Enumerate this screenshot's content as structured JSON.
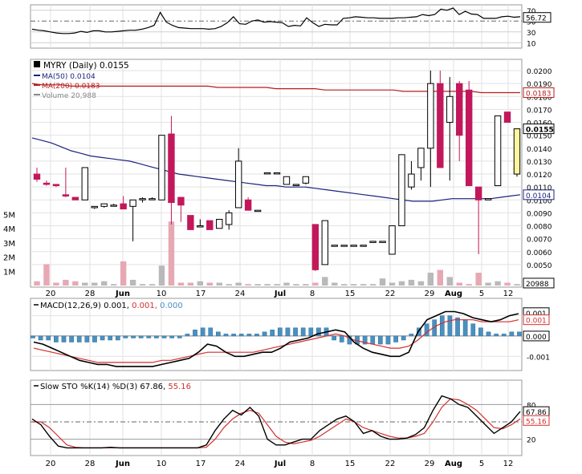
{
  "chart_data": [
    {
      "type": "line",
      "panel": "rsi",
      "y_ticks": [
        70,
        50,
        30,
        10
      ],
      "last_value": "56.72",
      "ylim": [
        0,
        80
      ],
      "series": [
        {
          "values": [
            35,
            33,
            32,
            30,
            28,
            27,
            27,
            28,
            31,
            29,
            32,
            32,
            30,
            30,
            31,
            32,
            33,
            33,
            35,
            38,
            42,
            66,
            48,
            42,
            38,
            37,
            36,
            36,
            36,
            35,
            36,
            40,
            47,
            58,
            45,
            44,
            50,
            52,
            48,
            49,
            48,
            47,
            40,
            42,
            41,
            56,
            47,
            40,
            44,
            43,
            43,
            55,
            56,
            58,
            57,
            56,
            56,
            55,
            55,
            55,
            56,
            56,
            57,
            58,
            62,
            60,
            62,
            72,
            70,
            74,
            62,
            68,
            63,
            62,
            55,
            55,
            55,
            58,
            59,
            57,
            58
          ]
        }
      ]
    },
    {
      "type": "candlestick",
      "panel": "price",
      "title": "MYRY (Daily) 0.0155",
      "legend": [
        {
          "label": "MA(50) 0.0104",
          "color": "#1a237e"
        },
        {
          "label": "MA(200) 0.0183",
          "color": "#b71c1c"
        },
        {
          "label": "Volume 20,988",
          "color": "#888888"
        }
      ],
      "price_ticks": [
        "0.0200",
        "0.0190",
        "0.0180",
        "0.0170",
        "0.0160",
        "0.0150",
        "0.0140",
        "0.0130",
        "0.0120",
        "0.0110",
        "0.0100",
        "0.0090",
        "0.0080",
        "0.0070",
        "0.0060",
        "0.0050"
      ],
      "volume_ticks": [
        "5M",
        "4M",
        "3M",
        "2M",
        "1M"
      ],
      "badges": [
        {
          "text": "0.0183",
          "color": "#b71c1c"
        },
        {
          "text": "0.0155",
          "color": "#000000"
        },
        {
          "text": "0.0104",
          "color": "#1a237e"
        },
        {
          "text": "20988",
          "color": "#000000"
        }
      ],
      "candles": [
        {
          "o": 0.012,
          "h": 0.0125,
          "l": 0.0114,
          "c": 0.0116,
          "v": 0.3
        },
        {
          "o": 0.0113,
          "h": 0.0115,
          "l": 0.0111,
          "c": 0.0112,
          "v": 1.5
        },
        {
          "o": 0.0112,
          "h": 0.0112,
          "l": 0.011,
          "c": 0.0111,
          "v": 0.2
        },
        {
          "o": 0.0104,
          "h": 0.0125,
          "l": 0.0102,
          "c": 0.0103,
          "v": 0.4
        },
        {
          "o": 0.0102,
          "h": 0.0102,
          "l": 0.01,
          "c": 0.01,
          "v": 0.3
        },
        {
          "o": 0.01,
          "h": 0.0125,
          "l": 0.01,
          "c": 0.0125,
          "v": 0.2
        },
        {
          "o": 0.0094,
          "h": 0.0095,
          "l": 0.0093,
          "c": 0.0095,
          "v": 0.2
        },
        {
          "o": 0.0095,
          "h": 0.0097,
          "l": 0.0094,
          "c": 0.0097,
          "v": 0.3
        },
        {
          "o": 0.0096,
          "h": 0.0097,
          "l": 0.0096,
          "c": 0.0096,
          "v": 0.1
        },
        {
          "o": 0.0097,
          "h": 0.0103,
          "l": 0.0094,
          "c": 0.0093,
          "v": 1.7
        },
        {
          "o": 0.0095,
          "h": 0.01,
          "l": 0.0068,
          "c": 0.01,
          "v": 0.4
        },
        {
          "o": 0.0101,
          "h": 0.0102,
          "l": 0.0098,
          "c": 0.0101,
          "v": 0.1
        },
        {
          "o": 0.0101,
          "h": 0.0102,
          "l": 0.01,
          "c": 0.0101,
          "v": 0.1
        },
        {
          "o": 0.01,
          "h": 0.015,
          "l": 0.01,
          "c": 0.015,
          "v": 1.4
        },
        {
          "o": 0.0151,
          "h": 0.0165,
          "l": 0.0081,
          "c": 0.0098,
          "v": 4.5
        },
        {
          "o": 0.0102,
          "h": 0.0102,
          "l": 0.0083,
          "c": 0.0096,
          "v": 0.2
        },
        {
          "o": 0.0088,
          "h": 0.0088,
          "l": 0.0077,
          "c": 0.0077,
          "v": 0.2
        },
        {
          "o": 0.008,
          "h": 0.0085,
          "l": 0.008,
          "c": 0.008,
          "v": 0.3
        },
        {
          "o": 0.0084,
          "h": 0.0084,
          "l": 0.0077,
          "c": 0.0077,
          "v": 0.2
        },
        {
          "o": 0.0078,
          "h": 0.0085,
          "l": 0.0078,
          "c": 0.0085,
          "v": 0.2
        },
        {
          "o": 0.0081,
          "h": 0.0092,
          "l": 0.0077,
          "c": 0.009,
          "v": 0.1
        },
        {
          "o": 0.0094,
          "h": 0.014,
          "l": 0.0094,
          "c": 0.013,
          "v": 0.2
        },
        {
          "o": 0.01,
          "h": 0.0102,
          "l": 0.0093,
          "c": 0.0092,
          "v": 0.1
        },
        {
          "o": 0.0092,
          "h": 0.0092,
          "l": 0.0092,
          "c": 0.0092,
          "v": 0.1
        },
        {
          "o": 0.0121,
          "h": 0.0121,
          "l": 0.0121,
          "c": 0.0121,
          "v": 0.1
        },
        {
          "o": 0.0121,
          "h": 0.0121,
          "l": 0.0121,
          "c": 0.0121,
          "v": 0.1
        },
        {
          "o": 0.0112,
          "h": 0.0118,
          "l": 0.0112,
          "c": 0.0118,
          "v": 0.2
        },
        {
          "o": 0.0112,
          "h": 0.0112,
          "l": 0.0112,
          "c": 0.0112,
          "v": 0.1
        },
        {
          "o": 0.0113,
          "h": 0.0118,
          "l": 0.0112,
          "c": 0.0118,
          "v": 0.1
        },
        {
          "o": 0.0081,
          "h": 0.0081,
          "l": 0.0045,
          "c": 0.0046,
          "v": 0.2
        },
        {
          "o": 0.005,
          "h": 0.0084,
          "l": 0.005,
          "c": 0.0084,
          "v": 0.6
        },
        {
          "o": 0.0065,
          "h": 0.0065,
          "l": 0.0065,
          "c": 0.0065,
          "v": 0.2
        },
        {
          "o": 0.0065,
          "h": 0.0065,
          "l": 0.0065,
          "c": 0.0065,
          "v": 0.1
        },
        {
          "o": 0.0065,
          "h": 0.0065,
          "l": 0.0065,
          "c": 0.0065,
          "v": 0.1
        },
        {
          "o": 0.0065,
          "h": 0.0065,
          "l": 0.0065,
          "c": 0.0065,
          "v": 0.1
        },
        {
          "o": 0.0068,
          "h": 0.0068,
          "l": 0.0068,
          "c": 0.0068,
          "v": 0.1
        },
        {
          "o": 0.0068,
          "h": 0.0068,
          "l": 0.0068,
          "c": 0.0068,
          "v": 0.5
        },
        {
          "o": 0.0058,
          "h": 0.008,
          "l": 0.0058,
          "c": 0.008,
          "v": 0.2
        },
        {
          "o": 0.008,
          "h": 0.0135,
          "l": 0.008,
          "c": 0.0135,
          "v": 0.3
        },
        {
          "o": 0.011,
          "h": 0.013,
          "l": 0.0108,
          "c": 0.012,
          "v": 0.4
        },
        {
          "o": 0.0125,
          "h": 0.014,
          "l": 0.0115,
          "c": 0.014,
          "v": 0.3
        },
        {
          "o": 0.014,
          "h": 0.02,
          "l": 0.011,
          "c": 0.019,
          "v": 0.9
        },
        {
          "o": 0.019,
          "h": 0.02,
          "l": 0.0125,
          "c": 0.0125,
          "v": 1.1
        },
        {
          "o": 0.016,
          "h": 0.0195,
          "l": 0.0115,
          "c": 0.018,
          "v": 0.6
        },
        {
          "o": 0.019,
          "h": 0.0192,
          "l": 0.013,
          "c": 0.015,
          "v": 0.2
        },
        {
          "o": 0.0185,
          "h": 0.0192,
          "l": 0.0111,
          "c": 0.0111,
          "v": 0.1
        },
        {
          "o": 0.011,
          "h": 0.011,
          "l": 0.0058,
          "c": 0.01,
          "v": 0.9
        },
        {
          "o": 0.01,
          "h": 0.0101,
          "l": 0.01,
          "c": 0.0101,
          "v": 0.2
        },
        {
          "o": 0.0111,
          "h": 0.0165,
          "l": 0.0111,
          "c": 0.0165,
          "v": 0.3
        },
        {
          "o": 0.0168,
          "h": 0.0168,
          "l": 0.016,
          "c": 0.016,
          "v": 0.2
        },
        {
          "o": 0.012,
          "h": 0.0155,
          "l": 0.0118,
          "c": 0.0155,
          "v": 0.1
        }
      ],
      "ma50": [
        0.0148,
        0.0146,
        0.0144,
        0.0141,
        0.0138,
        0.0136,
        0.0134,
        0.0133,
        0.0132,
        0.0131,
        0.013,
        0.0128,
        0.0126,
        0.0124,
        0.0122,
        0.012,
        0.0119,
        0.0118,
        0.0117,
        0.0116,
        0.0115,
        0.0114,
        0.0113,
        0.0112,
        0.0111,
        0.0111,
        0.011,
        0.011,
        0.011,
        0.0109,
        0.0108,
        0.0107,
        0.0106,
        0.0105,
        0.0104,
        0.0103,
        0.0102,
        0.0101,
        0.01,
        0.0099,
        0.0099,
        0.0099,
        0.01,
        0.0101,
        0.0101,
        0.0101,
        0.0101,
        0.0101,
        0.0102,
        0.0103,
        0.0104
      ],
      "ma200": [
        0.019,
        0.0189,
        0.0189,
        0.0189,
        0.0188,
        0.0188,
        0.0188,
        0.0188,
        0.0188,
        0.0188,
        0.0188,
        0.0188,
        0.0188,
        0.0188,
        0.0188,
        0.0188,
        0.0188,
        0.0188,
        0.0188,
        0.0187,
        0.0187,
        0.0187,
        0.0187,
        0.0187,
        0.0187,
        0.0186,
        0.0186,
        0.0186,
        0.0186,
        0.0186,
        0.0185,
        0.0185,
        0.0185,
        0.0185,
        0.0185,
        0.0185,
        0.0185,
        0.0185,
        0.0184,
        0.0184,
        0.0184,
        0.0184,
        0.0184,
        0.0184,
        0.0184,
        0.0184,
        0.0183,
        0.0183,
        0.0183,
        0.0183,
        0.0183
      ]
    },
    {
      "type": "bar",
      "panel": "macd",
      "title_parts": [
        {
          "text": "MACD(12,26,9) 0.001, ",
          "color": "#000000"
        },
        {
          "text": "0.001, ",
          "color": "#d32f2f"
        },
        {
          "text": "0.000",
          "color": "#4a90c0"
        }
      ],
      "y_ticks": [
        "0.001",
        "0.000",
        "-0.001"
      ],
      "badges": [
        {
          "text": "0.001",
          "color": "#000000"
        },
        {
          "text": "0.001",
          "color": "#d32f2f"
        },
        {
          "text": "0.000",
          "color": "#000000"
        }
      ],
      "histogram": [
        -0.0001,
        -0.0002,
        -0.0002,
        -0.0003,
        -0.0003,
        -0.0003,
        -0.0003,
        -0.0003,
        -0.0003,
        -0.0002,
        -0.0002,
        -0.0002,
        -0.0001,
        -0.0001,
        -0.0001,
        -0.0001,
        -0.0001,
        -0.0001,
        -0.0001,
        -0.0001,
        0.0001,
        0.0003,
        0.0004,
        0.0004,
        0.0002,
        0.0001,
        0.0001,
        0.0001,
        0.0001,
        0.0001,
        0.0002,
        0.0003,
        0.0004,
        0.0004,
        0.0004,
        0.0004,
        0.0004,
        0.0004,
        0.0004,
        -0.0002,
        -0.0003,
        -0.0004,
        -0.0004,
        -0.0004,
        -0.0004,
        -0.0004,
        -0.0004,
        -0.0003,
        -0.0002,
        0.0001,
        0.0004,
        0.0006,
        0.0008,
        0.001,
        0.001,
        0.0009,
        0.0008,
        0.0006,
        0.0004,
        0.0002,
        0.0001,
        0.0001,
        0.0002,
        0.0002
      ],
      "macd": [
        -0.0003,
        -0.0004,
        -0.0006,
        -0.0008,
        -0.001,
        -0.0012,
        -0.0013,
        -0.0014,
        -0.0014,
        -0.0015,
        -0.0015,
        -0.0015,
        -0.0015,
        -0.0015,
        -0.0014,
        -0.0013,
        -0.0012,
        -0.0011,
        -0.0008,
        -0.0004,
        -0.0005,
        -0.0008,
        -0.001,
        -0.001,
        -0.0009,
        -0.0008,
        -0.0008,
        -0.0006,
        -0.0003,
        -0.0002,
        -0.0001,
        0.0001,
        0.0002,
        0.0003,
        0.0002,
        -0.0003,
        -0.0006,
        -0.0008,
        -0.0009,
        -0.001,
        -0.001,
        -0.0008,
        0.0002,
        0.0008,
        0.001,
        0.0012,
        0.0012,
        0.0011,
        0.0009,
        0.0008,
        0.0007,
        0.0008,
        0.001,
        0.0011
      ],
      "signal": [
        -0.0006,
        -0.0007,
        -0.0008,
        -0.0009,
        -0.001,
        -0.0011,
        -0.0012,
        -0.0013,
        -0.0013,
        -0.0013,
        -0.0013,
        -0.0013,
        -0.0013,
        -0.0013,
        -0.0012,
        -0.0012,
        -0.0011,
        -0.001,
        -0.0009,
        -0.0008,
        -0.0008,
        -0.0008,
        -0.0008,
        -0.0008,
        -0.0008,
        -0.0007,
        -0.0006,
        -0.0005,
        -0.0004,
        -0.0003,
        -0.0002,
        -0.0001,
        0.0,
        0.0001,
        0.0,
        -0.0002,
        -0.0003,
        -0.0004,
        -0.0005,
        -0.0006,
        -0.0006,
        -0.0005,
        -0.0002,
        0.0002,
        0.0005,
        0.0007,
        0.0008,
        0.0008,
        0.0008,
        0.0007,
        0.0007,
        0.0007,
        0.0007,
        0.0008
      ]
    },
    {
      "type": "line",
      "panel": "stochastic",
      "title_parts": [
        {
          "text": "Slow STO %K(14) %D(3) 67.86, ",
          "color": "#000000"
        },
        {
          "text": "55.16",
          "color": "#d32f2f"
        }
      ],
      "y_ticks": [
        "80",
        "20"
      ],
      "badges": [
        {
          "text": "67.86",
          "color": "#000000"
        },
        {
          "text": "55.16",
          "color": "#d32f2f"
        }
      ],
      "ylim": [
        0,
        100
      ],
      "k": [
        55,
        45,
        25,
        8,
        5,
        5,
        5,
        5,
        5,
        6,
        5,
        5,
        5,
        5,
        5,
        5,
        5,
        5,
        5,
        5,
        10,
        35,
        55,
        70,
        62,
        75,
        60,
        20,
        10,
        10,
        15,
        20,
        20,
        35,
        45,
        55,
        60,
        50,
        30,
        35,
        25,
        20,
        20,
        22,
        28,
        40,
        70,
        95,
        90,
        80,
        75,
        60,
        45,
        30,
        40,
        50,
        67.86
      ],
      "d": [
        50,
        50,
        40,
        25,
        10,
        6,
        5,
        5,
        5,
        5,
        5,
        5,
        5,
        5,
        5,
        5,
        5,
        5,
        5,
        5,
        6,
        20,
        40,
        55,
        65,
        70,
        65,
        45,
        25,
        15,
        12,
        15,
        18,
        25,
        35,
        45,
        55,
        50,
        40,
        35,
        30,
        25,
        22,
        22,
        25,
        30,
        50,
        75,
        90,
        88,
        80,
        70,
        55,
        40,
        38,
        45,
        55.16
      ]
    }
  ],
  "x_axis_labels": [
    "20",
    "28",
    "Jun",
    "10",
    "17",
    "24",
    "Jul",
    "8",
    "15",
    "22",
    "29",
    "Aug",
    "5",
    "12"
  ]
}
